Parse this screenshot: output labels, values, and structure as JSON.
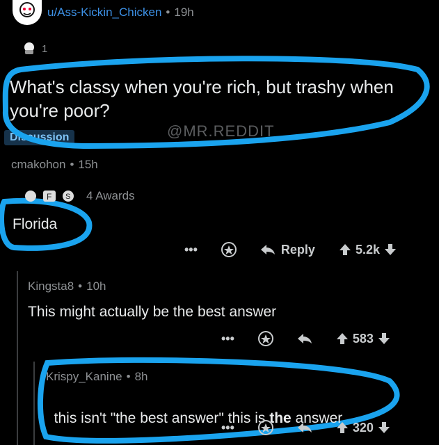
{
  "post": {
    "username": "u/Ass-Kickin_Chicken",
    "age": "19h",
    "award_count": "1",
    "title": "What's classy when you're rich, but trashy when you're poor?",
    "flair": "Discussion",
    "watermark": "@MR.REDDIT"
  },
  "comments": [
    {
      "author": "cmakohon",
      "age": "15h",
      "awards_label": "4 Awards",
      "text": "Florida",
      "reply_label": "Reply",
      "score": "5.2k"
    },
    {
      "author": "Kingsta8",
      "age": "10h",
      "text": "This might actually be the best answer",
      "score": "583"
    },
    {
      "author": "Krispy_Kanine",
      "age": "8h",
      "text_before": "this isn't \"the best answer\" this is ",
      "text_bold": "the",
      "text_after": " answer",
      "score": "320"
    }
  ],
  "icons": {
    "more": "ellipsis-icon",
    "award": "award-icon",
    "reply": "reply-arrow-icon",
    "upvote": "upvote-icon",
    "downvote": "downvote-icon"
  },
  "colors": {
    "highlight": "#1aa3ee",
    "flair_bg": "#16324a",
    "flair_text": "#7fc3f5",
    "link_blue": "#3d91e6"
  }
}
